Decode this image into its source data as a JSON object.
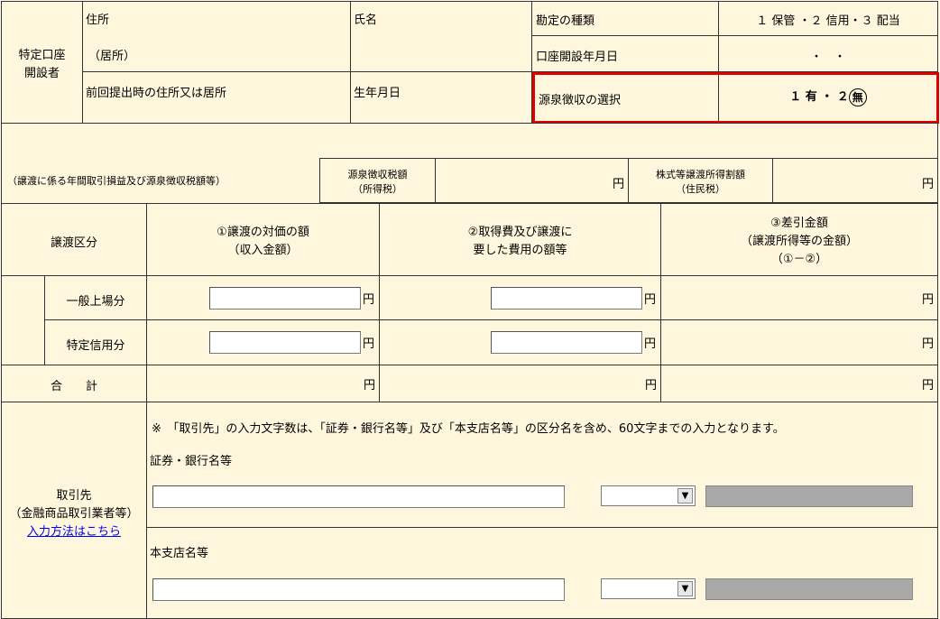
{
  "header": {
    "holder_label_line1": "特定口座",
    "holder_label_line2": "開設者",
    "address_label": "住所",
    "residence_label": "（居所）",
    "prev_address_label": "前回提出時の住所又は居所",
    "name_label": "氏名",
    "birth_label": "生年月日",
    "account_type_label": "勘定の種類",
    "account_type_value": "１ 保管 ・２ 信用・３ 配当",
    "open_date_label": "口座開設年月日",
    "open_date_value": "・　・",
    "withholding_label": "源泉徴収の選択",
    "withholding_value_prefix": "１ 有 ・ ２",
    "withholding_value_circled": "無"
  },
  "summary": {
    "annual_note": "（譲渡に係る年間取引損益及び源泉徴収税額等）",
    "withholding_tax_label1": "源泉徴収税額",
    "withholding_tax_label2": "（所得税）",
    "yen1": "円",
    "stock_tax_label1": "株式等譲渡所得割額",
    "stock_tax_label2": "（住民税）",
    "yen2": "円"
  },
  "table": {
    "col_category": "譲渡区分",
    "col1_line1": "①譲渡の対価の額",
    "col1_line2": "（収入金額）",
    "col2_line1": "②取得費及び譲渡に",
    "col2_line2": "要した費用の額等",
    "col3_line1": "③差引金額",
    "col3_line2": "（譲渡所得等の金額）",
    "col3_line3": "（①－②）",
    "rows": [
      {
        "label": "一般上場分",
        "yen": "円"
      },
      {
        "label": "特定信用分",
        "yen": "円"
      }
    ],
    "total_label": "合　　計",
    "yen": "円"
  },
  "counterparty": {
    "label_line1": "取引先",
    "label_line2": "（金融商品取引業者等）",
    "link": "入力方法はこちら",
    "note": "※　「取引先」の入力文字数は、「証券・銀行名等」及び「本支店名等」の区分名を含め、60文字までの入力となります。",
    "bank_label": "証券・銀行名等",
    "branch_label": "本支店名等",
    "bank_input_value": "",
    "branch_input_value": "",
    "select_value": ""
  },
  "colors": {
    "background": "#FFF7DD",
    "highlight_border": "#e00000",
    "link": "#0000EE"
  }
}
